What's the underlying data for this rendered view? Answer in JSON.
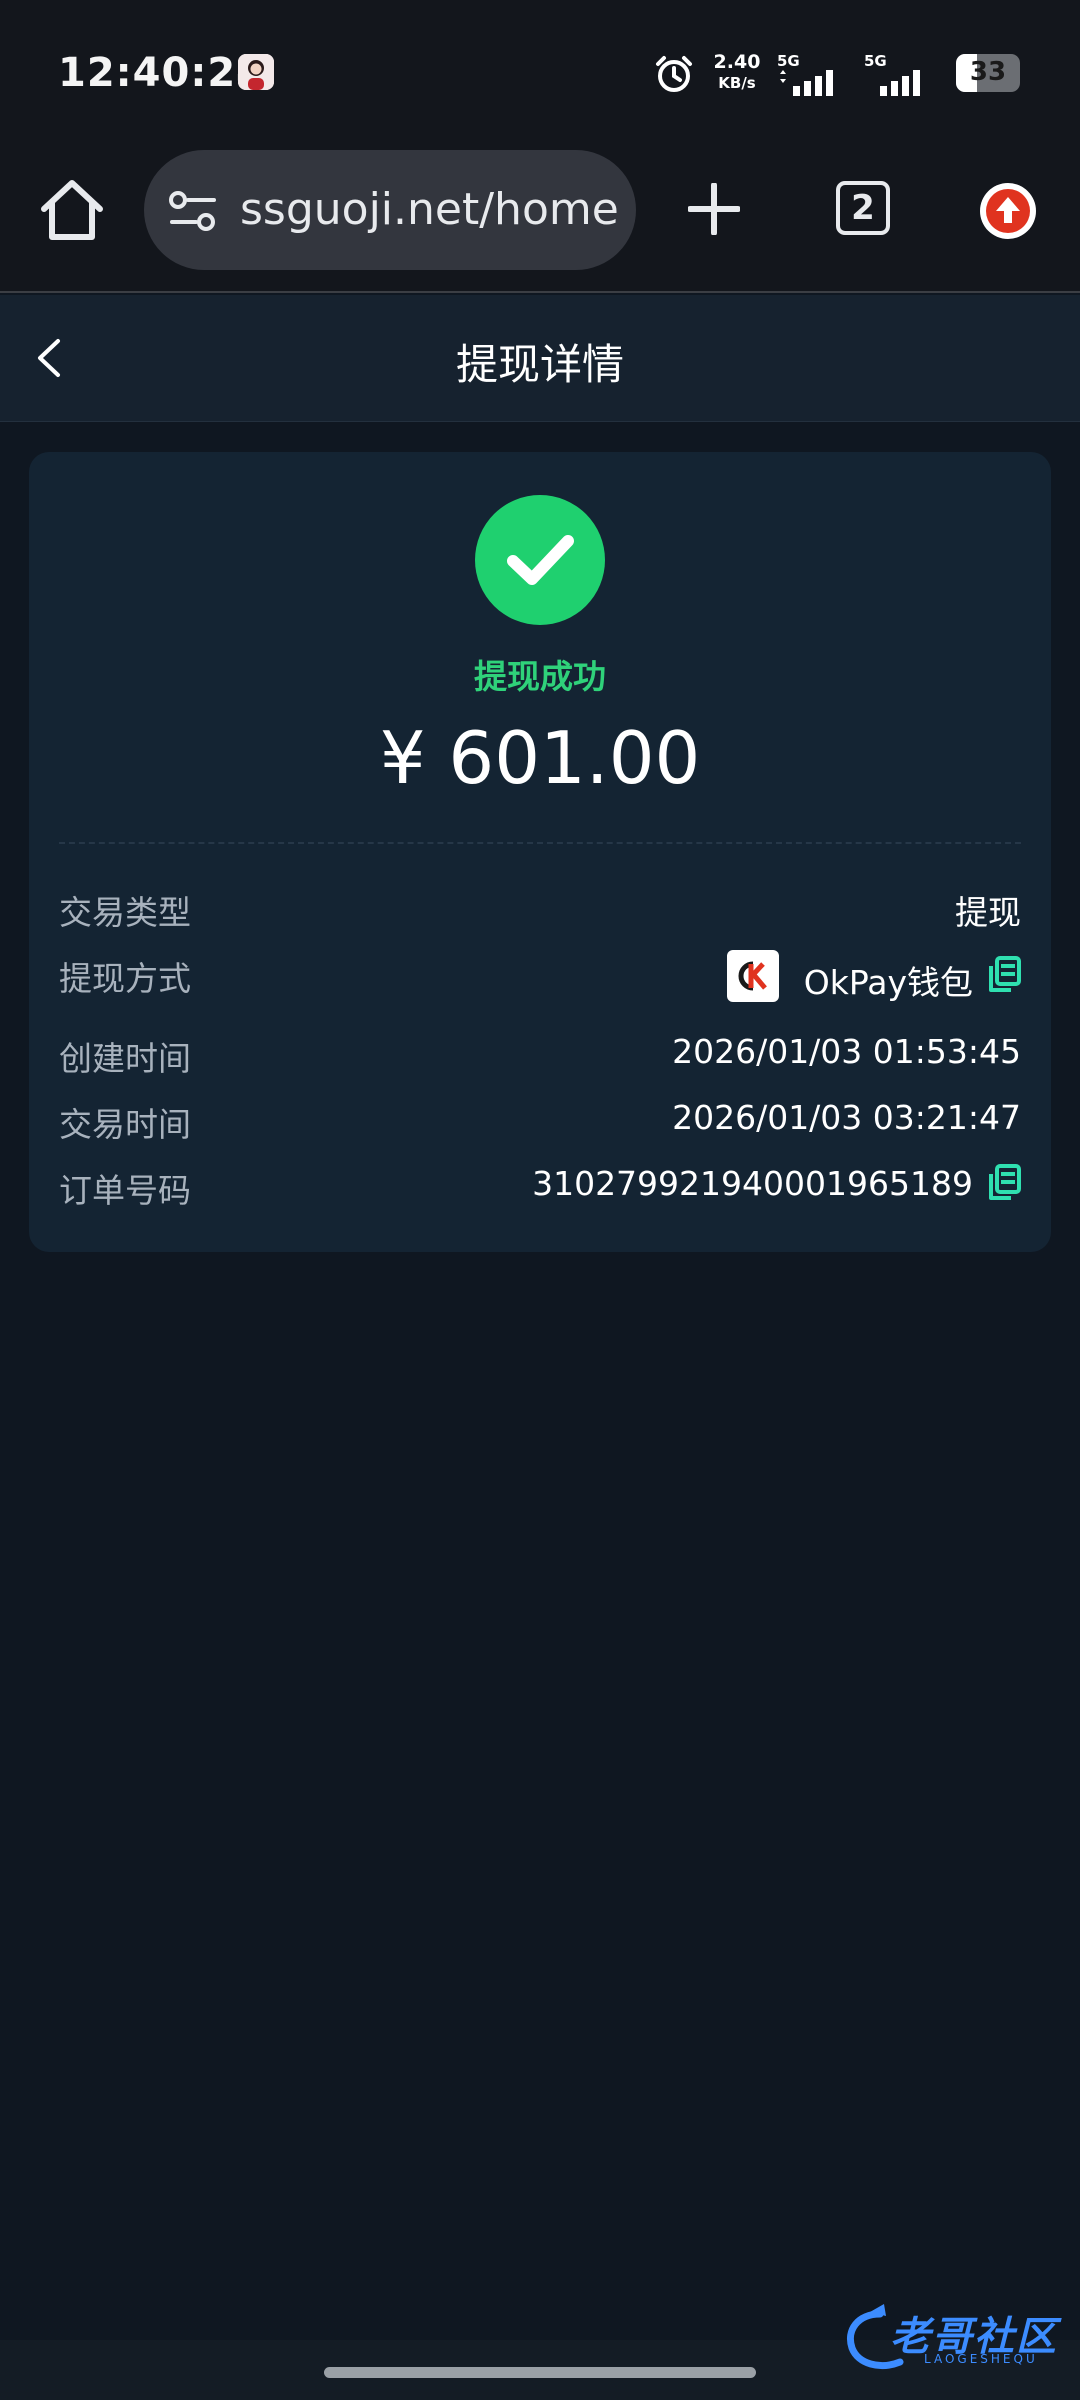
{
  "status_bar": {
    "time": "12:40:24",
    "net_speed_value": "2.40",
    "net_speed_unit": "KB/s",
    "signal_1_label": "5G",
    "signal_2_label": "5G",
    "battery_level": "33"
  },
  "browser": {
    "url": "ssguoji.net/home",
    "tab_count": "2"
  },
  "header": {
    "title": "提现详情"
  },
  "detail": {
    "status": "提现成功",
    "amount": "¥ 601.00",
    "rows": {
      "type_label": "交易类型",
      "type_value": "提现",
      "method_label": "提现方式",
      "method_value": "OkPay钱包",
      "created_label": "创建时间",
      "created_value": "2026/01/03 01:53:45",
      "trade_label": "交易时间",
      "trade_value": "2026/01/03 03:21:47",
      "order_label": "订单号码",
      "order_value": "310279921940001965189"
    }
  },
  "watermark": {
    "text": "老哥社区",
    "sub": "LAOGESHEQU"
  },
  "colors": {
    "success_green": "#1fd06f",
    "copy_teal": "#2fe0b0",
    "card_bg": "#142433"
  }
}
